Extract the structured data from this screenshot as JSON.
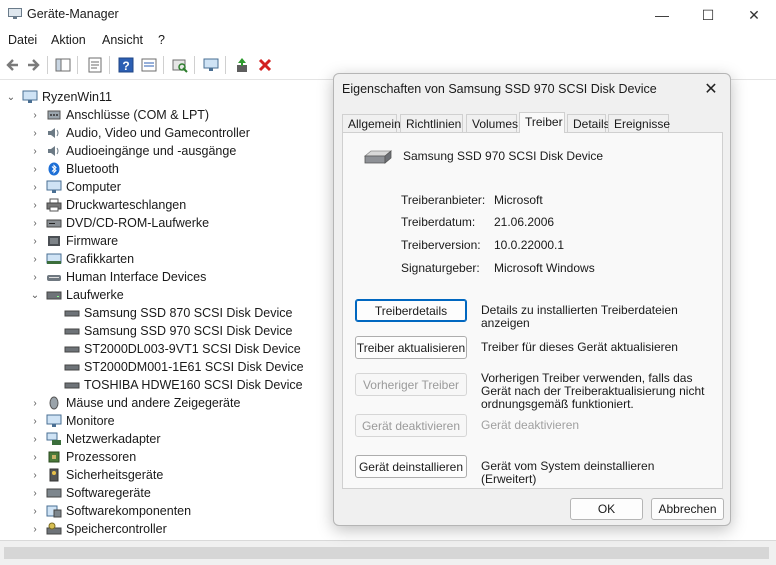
{
  "window": {
    "title": "Geräte-Manager",
    "controls": {
      "minimize": "—",
      "maximize": "☐",
      "close": "✕"
    }
  },
  "menu": [
    "Datei",
    "Aktion",
    "Ansicht",
    "?"
  ],
  "tree": {
    "root": "RyzenWin11",
    "categories": [
      "Anschlüsse (COM & LPT)",
      "Audio, Video und Gamecontroller",
      "Audioeingänge und -ausgänge",
      "Bluetooth",
      "Computer",
      "Druckwarteschlangen",
      "DVD/CD-ROM-Laufwerke",
      "Firmware",
      "Grafikkarten",
      "Human Interface Devices",
      "Laufwerke",
      "Mäuse und andere Zeigegeräte",
      "Monitore",
      "Netzwerkadapter",
      "Prozessoren",
      "Sicherheitsgeräte",
      "Softwaregeräte",
      "Softwarekomponenten",
      "Speichercontroller"
    ],
    "drives": [
      "Samsung SSD 870 SCSI Disk Device",
      "Samsung SSD 970 SCSI Disk Device",
      "ST2000DL003-9VT1 SCSI Disk Device",
      "ST2000DM001-1E61 SCSI Disk Device",
      "TOSHIBA HDWE160 SCSI Disk Device"
    ]
  },
  "dialog": {
    "title": "Eigenschaften von  Samsung SSD 970 SCSI Disk Device",
    "tabs": [
      "Allgemein",
      "Richtlinien",
      "Volumes",
      "Treiber",
      "Details",
      "Ereignisse"
    ],
    "active_tab": "Treiber",
    "device_name": "Samsung SSD 970 SCSI Disk Device",
    "props": [
      {
        "label": "Treiberanbieter:",
        "value": "Microsoft"
      },
      {
        "label": "Treiberdatum:",
        "value": "21.06.2006"
      },
      {
        "label": "Treiberversion:",
        "value": "10.0.22000.1"
      },
      {
        "label": "Signaturgeber:",
        "value": "Microsoft Windows"
      }
    ],
    "actions": [
      {
        "button": "Treiberdetails",
        "desc": "Details zu installierten Treiberdateien anzeigen"
      },
      {
        "button": "Treiber aktualisieren",
        "desc": "Treiber für dieses Gerät aktualisieren"
      },
      {
        "button": "Vorheriger Treiber",
        "desc": "Vorherigen Treiber verwenden, falls das Gerät nach der Treiberaktualisierung nicht ordnungsgemäß funktioniert."
      },
      {
        "button": "Gerät deaktivieren",
        "desc": "Gerät deaktivieren"
      },
      {
        "button": "Gerät deinstallieren",
        "desc": "Gerät vom System deinstallieren (Erweitert)"
      }
    ],
    "ok": "OK",
    "cancel": "Abbrechen"
  }
}
